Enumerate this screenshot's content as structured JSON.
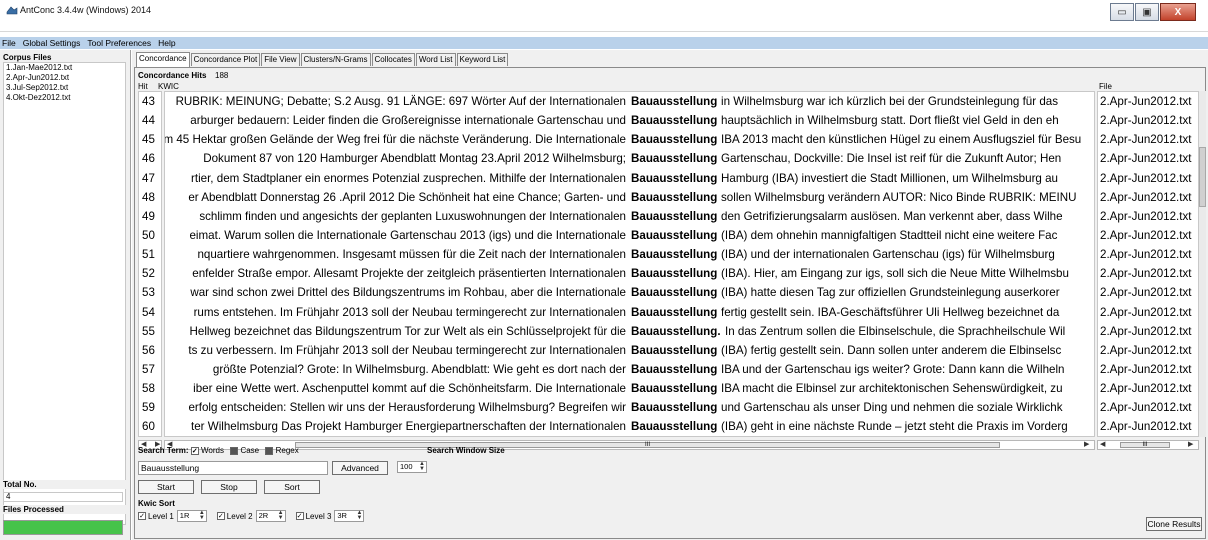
{
  "window": {
    "title": "AntConc 3.4.4w (Windows) 2014",
    "minimize": "▭",
    "maximize": "▣",
    "close": "X"
  },
  "menu": [
    "File",
    "Global Settings",
    "Tool Preferences",
    "Help"
  ],
  "left_panel": {
    "corpus_header": "Corpus Files",
    "files": [
      "1.Jan-Mae2012.txt",
      "2.Apr-Jun2012.txt",
      "3.Jul-Sep2012.txt",
      "4.Okt-Dez2012.txt"
    ],
    "total_label": "Total No.",
    "total_value": "4",
    "files_processed_label": "Files Processed",
    "progress": 1.0
  },
  "tabs": [
    "Concordance",
    "Concordance Plot",
    "File View",
    "Clusters/N-Grams",
    "Collocates",
    "Word List",
    "Keyword List"
  ],
  "concordance": {
    "hits_label": "Concordance Hits",
    "hits_count": "188",
    "col_hit": "Hit",
    "col_kwic": "KWIC",
    "col_file": "File",
    "rows": [
      {
        "hit": "43",
        "left": "RUBRIK: MEINUNG; Debatte; S.2 Ausg. 91 LÄNGE:  697 Wörter  Auf der Internationalen",
        "node": "Bauausstellung",
        "right": "in Wilhelmsburg war ich kürzlich bei der Grundsteinlegung für das",
        "file": "2.Apr-Jun2012.txt"
      },
      {
        "hit": "44",
        "left": "arburger bedauern: Leider finden die Großereignisse internationale Gartenschau und",
        "node": "Bauausstellung",
        "right": "hauptsächlich in Wilhelmsburg statt. Dort fließt viel Geld in den eh",
        "file": "2.Apr-Jun2012.txt"
      },
      {
        "hit": "45",
        "left": "em 45 Hektar großen Gelände der Weg frei für die nächste Veränderung. Die Internationale",
        "node": "Bauausstellung",
        "right": "IBA 2013 macht den künstlichen Hügel zu einem Ausflugsziel für Besu",
        "file": "2.Apr-Jun2012.txt"
      },
      {
        "hit": "46",
        "left": "Dokument 87 von 120  Hamburger Abendblatt Montag 23.April 2012 Wilhelmsburg;",
        "node": "Bauausstellung",
        "right": "Gartenschau, Dockville: Die Insel ist reif für die Zukunft Autor; Hen",
        "file": "2.Apr-Jun2012.txt"
      },
      {
        "hit": "47",
        "left": "rtier, dem Stadtplaner ein enormes Potenzial zusprechen. Mithilfe der Internationalen",
        "node": "Bauausstellung",
        "right": "Hamburg (IBA) investiert die Stadt Millionen, um Wilhelmsburg au",
        "file": "2.Apr-Jun2012.txt"
      },
      {
        "hit": "48",
        "left": "er Abendblatt Donnerstag 26 .April 2012 Die Schönheit hat eine Chance; Garten- und",
        "node": "Bauausstellung",
        "right": "sollen Wilhelmsburg verändern AUTOR: Nico Binde RUBRIK: MEINU",
        "file": "2.Apr-Jun2012.txt"
      },
      {
        "hit": "49",
        "left": "schlimm finden und angesichts der geplanten Luxuswohnungen der Internationalen",
        "node": "Bauausstellung",
        "right": "den Getrifizierungsalarm auslösen. Man verkennt aber, dass Wilhe",
        "file": "2.Apr-Jun2012.txt"
      },
      {
        "hit": "50",
        "left": "eimat. Warum sollen die Internationale Gartenschau 2013 (igs) und die Internationale",
        "node": "Bauausstellung",
        "right": "(IBA) dem ohnehin mannigfaltigen Stadtteil nicht eine weitere Fac",
        "file": "2.Apr-Jun2012.txt"
      },
      {
        "hit": "51",
        "left": "nquartiere wahrgenommen. Insgesamt müssen für die Zeit nach der Internationalen",
        "node": "Bauausstellung",
        "right": "(IBA) und der internationalen Gartenschau (igs) für Wilhelmsburg",
        "file": "2.Apr-Jun2012.txt"
      },
      {
        "hit": "52",
        "left": "enfelder Straße empor. Allesamt Projekte der zeitgleich präsentierten Internationalen",
        "node": "Bauausstellung",
        "right": "(IBA). Hier, am Eingang zur igs, soll sich die Neue Mitte Wilhelmsbu",
        "file": "2.Apr-Jun2012.txt"
      },
      {
        "hit": "53",
        "left": "war sind schon zwei Drittel des Bildungszentrums im Rohbau, aber die Internationale",
        "node": "Bauausstellung",
        "right": "(IBA) hatte diesen Tag zur offiziellen Grundsteinlegung auserkorer",
        "file": "2.Apr-Jun2012.txt"
      },
      {
        "hit": "54",
        "left": "rums entstehen. Im Frühjahr 2013 soll der Neubau termingerecht zur Internationalen",
        "node": "Bauausstellung",
        "right": "fertig gestellt sein. IBA-Geschäftsführer Uli Hellweg bezeichnet da",
        "file": "2.Apr-Jun2012.txt"
      },
      {
        "hit": "55",
        "left": "Hellweg bezeichnet das Bildungszentrum Tor zur Welt  als ein Schlüsselprojekt für die",
        "node": "Bauausstellung.",
        "right": "In das Zentrum sollen die Elbinselschule, die Sprachheilschule Wil",
        "file": "2.Apr-Jun2012.txt"
      },
      {
        "hit": "56",
        "left": "ts zu verbessern. Im Frühjahr 2013 soll der Neubau termingerecht zur Internationalen",
        "node": "Bauausstellung",
        "right": "(IBA) fertig gestellt sein. Dann sollen unter anderem die Elbinselsc",
        "file": "2.Apr-Jun2012.txt"
      },
      {
        "hit": "57",
        "left": "größte Potenzial? Grote: In Wilhelmsburg. Abendblatt: Wie geht es dort nach der",
        "node": "Bauausstellung",
        "right": "IBA und der Gartenschau igs weiter? Grote: Dann kann die Wilheln",
        "file": "2.Apr-Jun2012.txt"
      },
      {
        "hit": "58",
        "left": "iber eine Wette wert. Aschenputtel kommt auf die Schönheitsfarm. Die Internationale",
        "node": "Bauausstellung",
        "right": "IBA macht die Elbinsel zur architektonischen Sehenswürdigkeit, zu",
        "file": "2.Apr-Jun2012.txt"
      },
      {
        "hit": "59",
        "left": "erfolg entscheiden: Stellen wir uns der Herausforderung Wilhelmsburg? Begreifen wir",
        "node": "Bauausstellung",
        "right": "und Gartenschau als unser Ding und nehmen die soziale Wirklichk",
        "file": "2.Apr-Jun2012.txt"
      },
      {
        "hit": "60",
        "left": "ter Wilhelmsburg Das Projekt Hamburger Energiepartnerschaften der Internationalen",
        "node": "Bauausstellung",
        "right": "(IBA) geht in eine nächste Runde – jetzt steht die Praxis im Vorderg",
        "file": "2.Apr-Jun2012.txt"
      }
    ],
    "scroll_thumb_label": "III"
  },
  "search": {
    "search_term_label": "Search Term:",
    "words_label": "Words",
    "case_label": "Case",
    "regex_label": "Regex",
    "window_size_label": "Search Window Size",
    "term_value": "Bauausstellung",
    "advanced_label": "Advanced",
    "window_size_value": "100",
    "start_label": "Start",
    "stop_label": "Stop",
    "sort_label": "Sort"
  },
  "kwic_sort": {
    "label": "Kwic Sort",
    "levels": [
      {
        "label": "Level 1",
        "value": "1R"
      },
      {
        "label": "Level 2",
        "value": "2R"
      },
      {
        "label": "Level 3",
        "value": "3R"
      }
    ],
    "clone_label": "Clone Results"
  }
}
